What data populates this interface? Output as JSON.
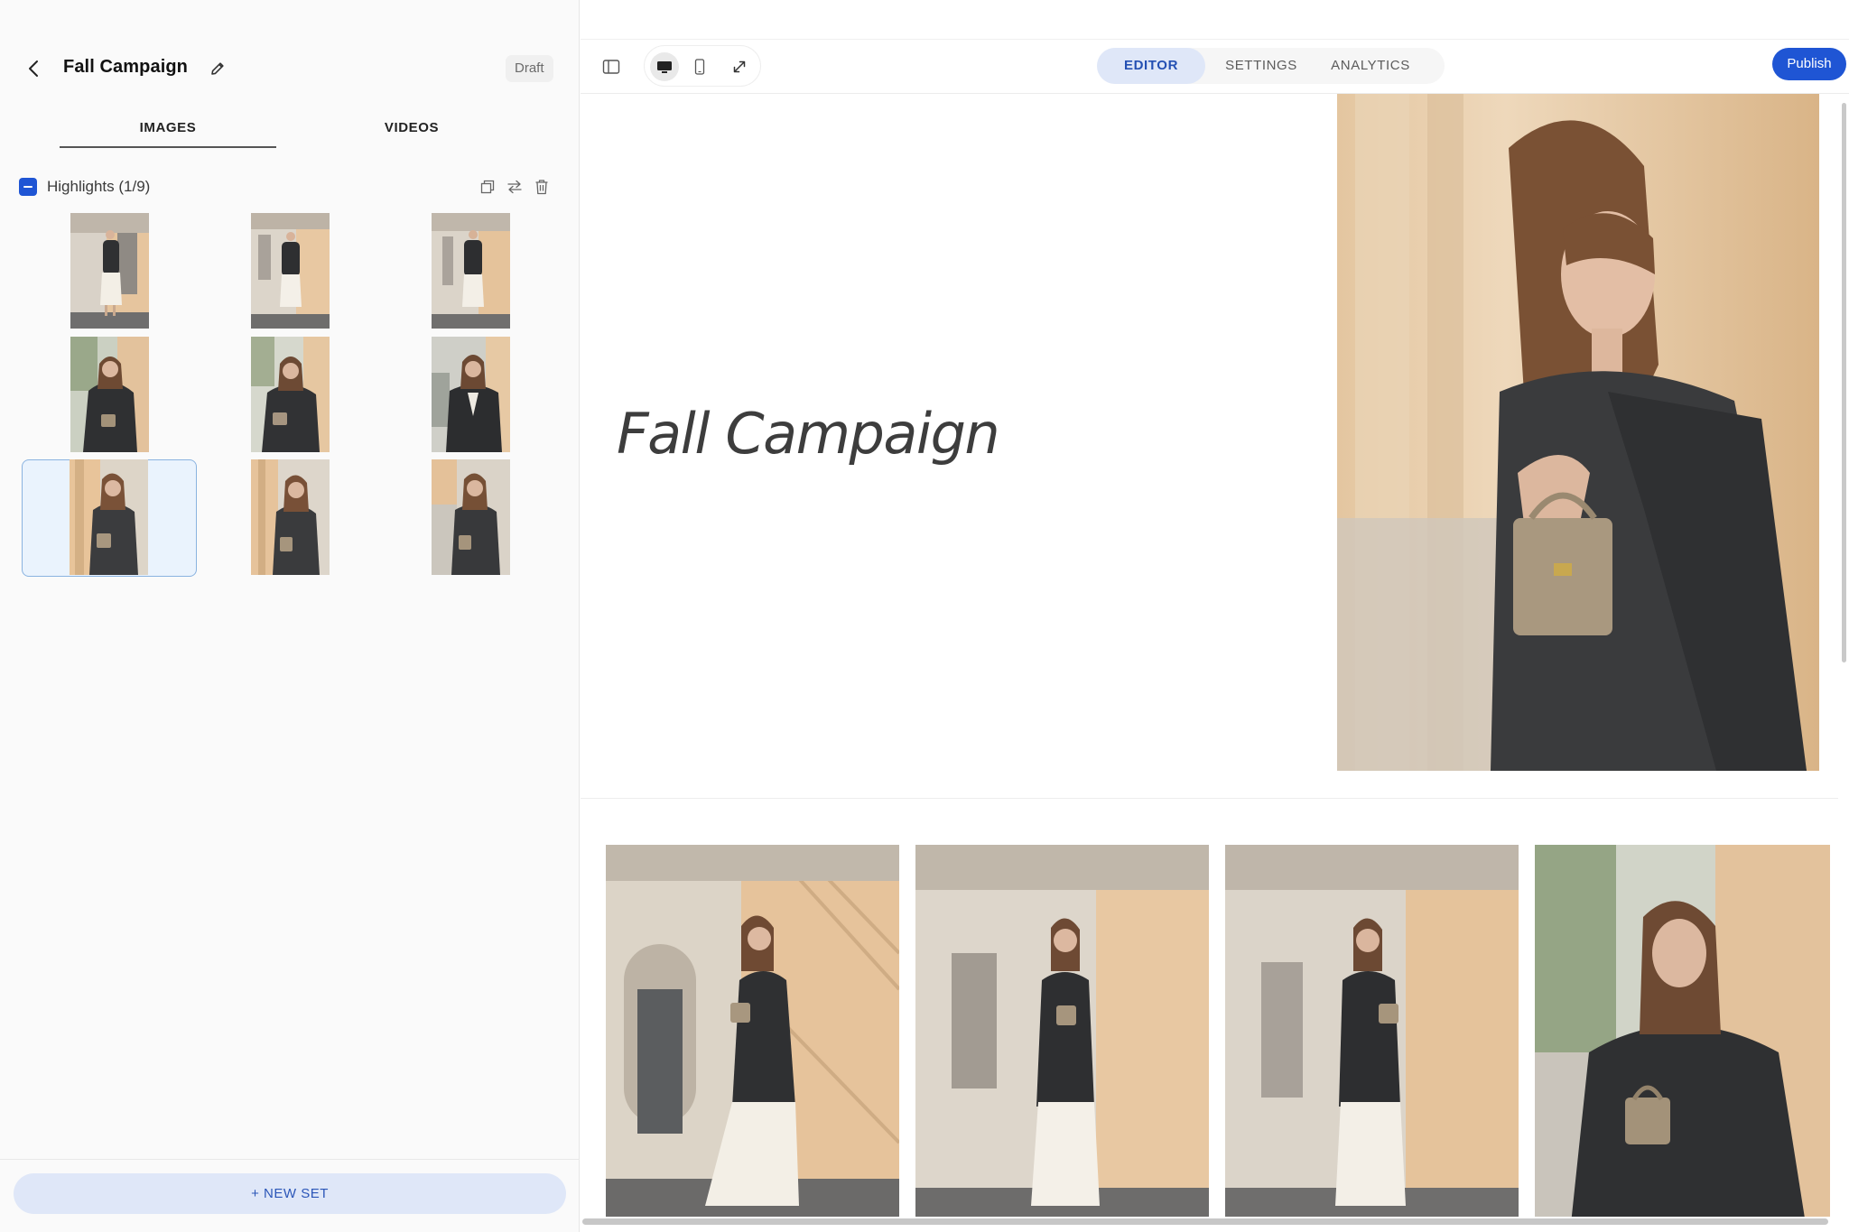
{
  "sidebar": {
    "title": "Fall Campaign",
    "status_badge": "Draft",
    "tabs": [
      {
        "label": "IMAGES",
        "active": true
      },
      {
        "label": "VIDEOS",
        "active": false
      }
    ],
    "set": {
      "label": "Highlights (1/9)",
      "checked": "partial",
      "actions": [
        "duplicate-icon",
        "swap-icon",
        "trash-icon"
      ]
    },
    "thumbnails": [
      {
        "scene": "full-body-wall",
        "selected": false
      },
      {
        "scene": "full-body-wall",
        "selected": false
      },
      {
        "scene": "full-body-wall",
        "selected": false
      },
      {
        "scene": "portrait-tree",
        "selected": false
      },
      {
        "scene": "portrait-tree",
        "selected": false
      },
      {
        "scene": "portrait-street",
        "selected": false
      },
      {
        "scene": "portrait-bag",
        "selected": true
      },
      {
        "scene": "portrait-bag",
        "selected": false
      },
      {
        "scene": "portrait-bag",
        "selected": false
      }
    ],
    "new_set_label": "+ NEW SET"
  },
  "toolbar": {
    "panel_toggle_icon": "sidebar-toggle-icon",
    "devices": [
      {
        "name": "desktop-icon",
        "active": true
      },
      {
        "name": "mobile-icon",
        "active": false
      },
      {
        "name": "expand-icon",
        "active": false
      }
    ],
    "modes": [
      {
        "label": "EDITOR",
        "active": true
      },
      {
        "label": "SETTINGS",
        "active": false
      },
      {
        "label": "ANALYTICS",
        "active": false
      }
    ],
    "publish_label": "Publish"
  },
  "canvas": {
    "hero_title": "Fall Campaign",
    "gallery_count": 4
  },
  "colors": {
    "accent": "#1f55d4",
    "accent_soft": "#dfe7f8",
    "selected_bg": "#eaf3fd",
    "jacket": "#3a3b3d",
    "wall_peach": "#e6c59e",
    "wall_stone": "#d8cfc2"
  }
}
